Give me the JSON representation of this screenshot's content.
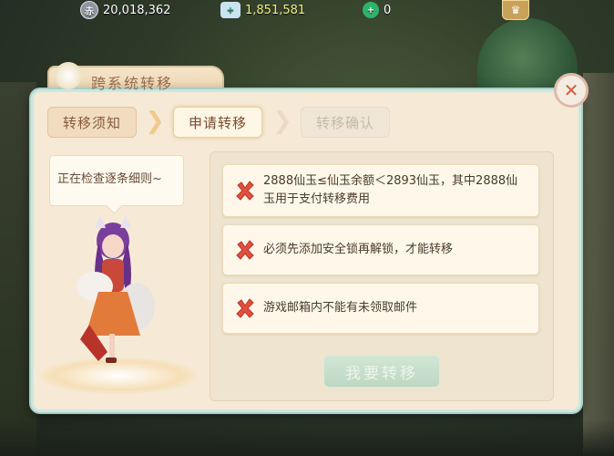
{
  "resources": {
    "silver": {
      "icon": "silver-coin-icon",
      "value": "20,018,362",
      "icon_glyph": "赤"
    },
    "jade": {
      "icon": "jade-ingot-icon",
      "value": "1,851,581",
      "icon_glyph": "+"
    },
    "gem": {
      "icon": "green-gem-icon",
      "value": "0",
      "icon_glyph": "+"
    }
  },
  "dialog": {
    "title": "跨系统转移",
    "close_glyph": "✕",
    "steps": [
      {
        "label": "转移须知",
        "state": "done"
      },
      {
        "label": "申请转移",
        "state": "active"
      },
      {
        "label": "转移确认",
        "state": "disabled"
      }
    ],
    "speech": "正在检查逐条细则~",
    "conditions": [
      {
        "text": "2888仙玉≤仙玉余额＜2893仙玉，其中2888仙玉用于支付转移费用",
        "status": "failed"
      },
      {
        "text": "必须先添加安全锁再解锁，才能转移",
        "status": "failed"
      },
      {
        "text": "游戏邮箱内不能有未领取邮件",
        "status": "failed"
      }
    ],
    "submit_label": "我要转移"
  },
  "colors": {
    "panel_bg": "#f6ead6",
    "fail_red": "#e0503c",
    "submit_green": "#b4d6c0"
  }
}
